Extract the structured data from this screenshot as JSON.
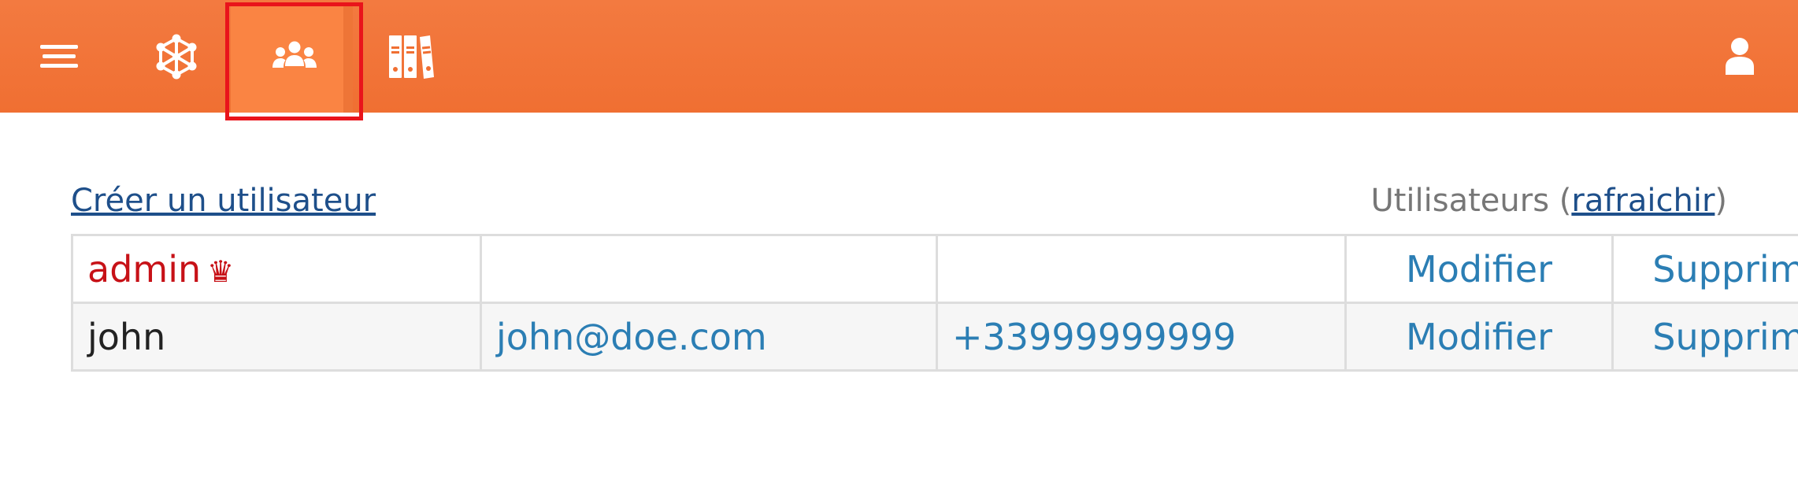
{
  "nav": {
    "items": [
      {
        "name": "menu",
        "icon": "hamburger-menu-icon"
      },
      {
        "name": "network",
        "icon": "network-icon"
      },
      {
        "name": "users",
        "icon": "users-group-icon",
        "active": true
      },
      {
        "name": "library",
        "icon": "binders-library-icon"
      }
    ],
    "account_icon": "user-account-icon",
    "colors": {
      "bar": "#f06f32",
      "active_tab": "#fa8443",
      "highlight": "#e9141b"
    }
  },
  "page": {
    "create_user_link": "Créer un utilisateur",
    "users_label_prefix": "Utilisateurs (",
    "refresh_link": "rafraichir",
    "users_label_suffix": ")"
  },
  "users": [
    {
      "name": "admin",
      "is_admin": true,
      "crown": "♛",
      "email": "",
      "phone": "",
      "edit": "Modifier",
      "delete": "Supprimer"
    },
    {
      "name": "john",
      "is_admin": false,
      "email": "john@doe.com",
      "phone": "+33999999999",
      "edit": "Modifier",
      "delete": "Supprimer"
    }
  ],
  "colors": {
    "link": "#2b7eb4",
    "admin": "#c71117",
    "heading_link": "#1e4f8a"
  }
}
